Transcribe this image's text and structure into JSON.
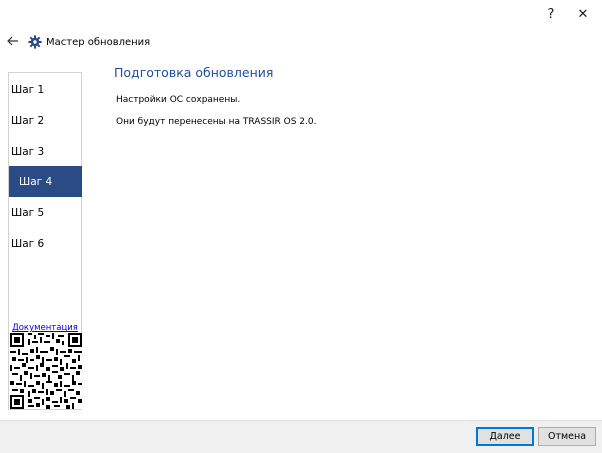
{
  "window": {
    "help_label": "?",
    "close_label": "✕"
  },
  "header": {
    "back_icon": "back-arrow-icon",
    "gear_icon": "gear-icon",
    "title": "Мастер обновления"
  },
  "sidebar": {
    "steps": [
      {
        "label": "Шаг 1",
        "active": false
      },
      {
        "label": "Шаг 2",
        "active": false
      },
      {
        "label": "Шаг 3",
        "active": false
      },
      {
        "label": "Шаг 4",
        "active": true
      },
      {
        "label": "Шаг 5",
        "active": false
      },
      {
        "label": "Шаг 6",
        "active": false
      }
    ],
    "doc_link": "Документация"
  },
  "main": {
    "heading": "Подготовка обновления",
    "line1": "Настройки ОС сохранены.",
    "line2": "Они будут перенесены на TRASSIR OS 2.0."
  },
  "footer": {
    "next_label": "Далее",
    "cancel_label": "Отмена"
  },
  "colors": {
    "accent": "#2b4b86",
    "heading": "#1f4e9b",
    "link": "#0000ee"
  }
}
